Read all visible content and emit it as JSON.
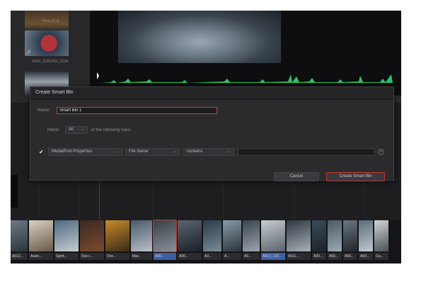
{
  "media_pool": {
    "items": [
      {
        "label": "Tofino [3-3]"
      },
      {
        "label": "A010_11301401_C034"
      },
      {
        "label": ""
      }
    ],
    "audio_note_icon": "music-note-icon"
  },
  "dialog": {
    "title": "Create Smart Bin",
    "name_label": "Name:",
    "name_value": "Smart Bin 1",
    "match_label": "Match",
    "match_value": "All",
    "rules_suffix": "of the following rules:",
    "rule": {
      "category": "MediaPool Properties",
      "field": "File Name",
      "operator": "contains",
      "value": ""
    },
    "cancel_label": "Cancel",
    "create_label": "Create Smart Bin"
  },
  "filmstrip": {
    "clips": [
      {
        "label": "A012..."
      },
      {
        "label": "Assin..."
      },
      {
        "label": "Spirit..."
      },
      {
        "label": "Des c..."
      },
      {
        "label": "Ove..."
      },
      {
        "label": "Mar..."
      },
      {
        "label": "A00..."
      },
      {
        "label": "A00..."
      },
      {
        "label": "A0..."
      },
      {
        "label": "A..."
      },
      {
        "label": "A0..."
      },
      {
        "label": "A013_120..."
      },
      {
        "label": "A011..."
      },
      {
        "label": "A00..."
      },
      {
        "label": "A00..."
      },
      {
        "label": "A00..."
      },
      {
        "label": "A00..."
      },
      {
        "label": "Ca..."
      }
    ]
  },
  "colors": {
    "accent_red": "#c0392b",
    "selection_blue": "#3d5fa3",
    "waveform_green": "#2ec26a"
  }
}
